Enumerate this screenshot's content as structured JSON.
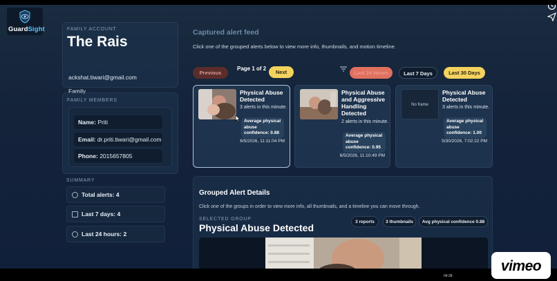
{
  "app": {
    "logo_part1": "Guard",
    "logo_part2": "Sight"
  },
  "account": {
    "label": "FAMILY ACCOUNT",
    "name": "The Rais",
    "email": "ackshat.tiwari@gmail.com",
    "type": "Family"
  },
  "family": {
    "label": "FAMILY MEMBERS",
    "name_label": "Name:",
    "name": "Priti",
    "email_label": "Email:",
    "email": "dr.priti.tiwari@gmail.com",
    "phone_label": "Phone:",
    "phone": "2015657805"
  },
  "summary": {
    "label": "SUMMARY",
    "total": "Total alerts: 4",
    "last7": "Last 7 days: 4",
    "last24": "Last 24 hours: 2"
  },
  "feed": {
    "title": "Captured alert feed",
    "subtitle": "Click one of the grouped alerts below to view more info, thumbnails, and motion timeline.",
    "prev": "Previous",
    "page": "Page 1 of 2",
    "next": "Next",
    "filters": {
      "d24": "Last 24 Hours",
      "d7": "Last 7 Days",
      "d30": "Last 30 Days"
    },
    "cards": [
      {
        "title": "Physical Abuse Detected",
        "count": "3 alerts in this minute.",
        "conf": "Average physical abuse confidence: 0.88",
        "date": "6/5/2026, 11:11:04 PM"
      },
      {
        "title": "Physical Abuse and Aggressive Handling Detected",
        "count": "2 alerts in this minute.",
        "conf": "Average physical abuse confidence: 0.95",
        "date": "6/5/2026, 11:10:49 PM"
      },
      {
        "title": "Physical Abuse Detected",
        "count": "3 alerts in this minute.",
        "conf": "Average physical abuse confidence: 1.00",
        "date": "5/30/2026, 7:02:22 PM",
        "thumb": "No frame"
      }
    ]
  },
  "details": {
    "title": "Grouped Alert Details",
    "hint": "Click one of the groups in order to view more info, all thumbnails, and a timeline you can move through.",
    "selected_label": "SELECTED GROUP",
    "group_name": "Physical Abuse Detected",
    "pills": [
      "3 reports",
      "3 thumbnails",
      "Avg physical confidence 0.88"
    ]
  },
  "player": {
    "brand": "vimeo",
    "time": "04:28"
  }
}
